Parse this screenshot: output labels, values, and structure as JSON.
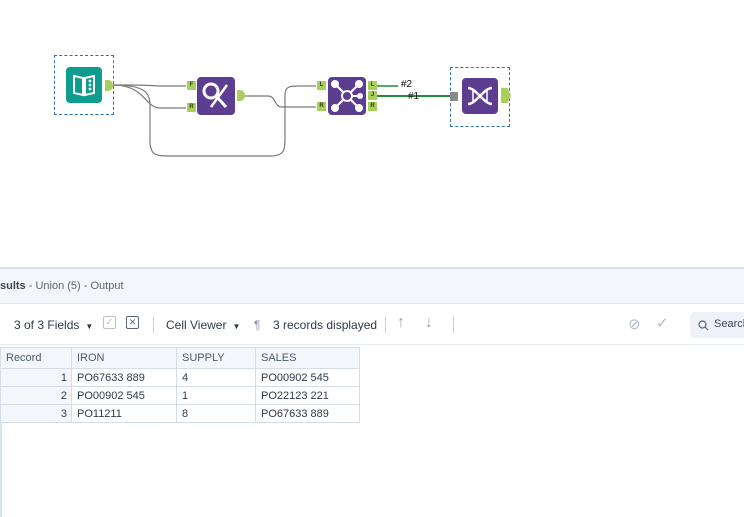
{
  "canvas": {
    "tools": [
      {
        "id": "input",
        "name": "Input Data",
        "color": "#0f9b8e"
      },
      {
        "id": "find-replace",
        "name": "Find Replace",
        "color": "#5c3d8f",
        "anchors_in": [
          "F",
          "R"
        ]
      },
      {
        "id": "join",
        "name": "Join",
        "color": "#5c3d8f",
        "anchors_in": [
          "L",
          "R"
        ],
        "anchors_out": [
          "L",
          "J",
          "R"
        ]
      },
      {
        "id": "union",
        "name": "Union",
        "color": "#5c3d8f"
      }
    ],
    "connection_labels": [
      "#2",
      "#1"
    ]
  },
  "results": {
    "title_bold": "sults",
    "title_rest": " - Union (5) - Output"
  },
  "toolbar": {
    "fields_label": "3 of 3 Fields",
    "cell_viewer_label": "Cell Viewer",
    "pilcrow": "¶",
    "records_label": "3 records displayed",
    "search_placeholder": "Search"
  },
  "table": {
    "columns": [
      "Record",
      "IRON",
      "SUPPLY",
      "SALES"
    ],
    "rows": [
      {
        "record": "1",
        "iron": "PO67633 889",
        "supply": "4",
        "sales": "PO00902 545"
      },
      {
        "record": "2",
        "iron": "PO00902 545",
        "supply": "1",
        "sales": "PO22123 221"
      },
      {
        "record": "3",
        "iron": "PO11211",
        "supply": "8",
        "sales": "PO67633 889"
      }
    ]
  }
}
